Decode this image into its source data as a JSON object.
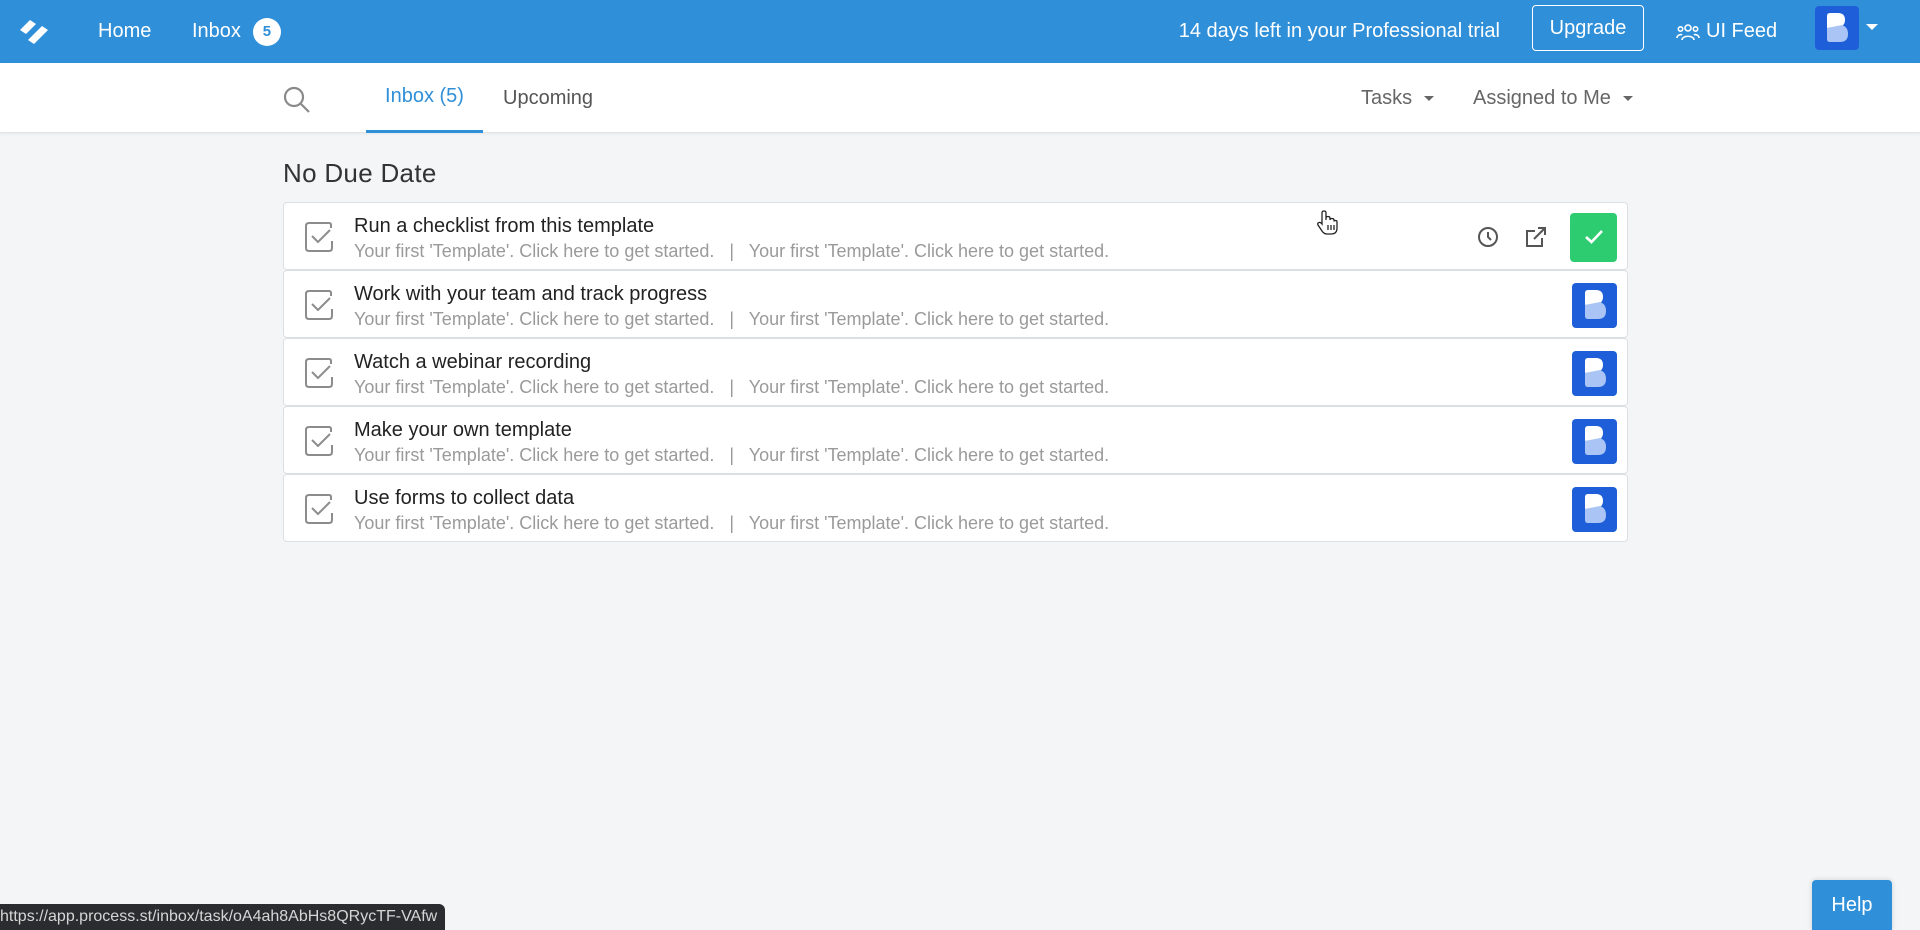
{
  "topnav": {
    "logo_icon": "process-street-logo",
    "home_label": "Home",
    "inbox_label": "Inbox",
    "inbox_count": "5",
    "trial_text": "14 days left in your Professional trial",
    "upgrade_label": "Upgrade",
    "uifeed_label": "UI Feed",
    "uifeed_icon": "users-icon",
    "avatar_icon": "user-avatar"
  },
  "subnav": {
    "search_icon": "search-icon",
    "tabs": [
      {
        "label": "Inbox (5)",
        "active": true
      },
      {
        "label": "Upcoming",
        "active": false
      }
    ],
    "filters": [
      {
        "label": "Tasks"
      },
      {
        "label": "Assigned to Me"
      }
    ]
  },
  "section": {
    "title": "No Due Date"
  },
  "tasks": [
    {
      "title": "Run a checklist from this template",
      "subtitle": "Your first 'Template'. Click here to get started.   |   Your first 'Template'. Click here to get started.",
      "hovered": true
    },
    {
      "title": "Work with your team and track progress",
      "subtitle": "Your first 'Template'. Click here to get started.   |   Your first 'Template'. Click here to get started.",
      "hovered": false
    },
    {
      "title": "Watch a webinar recording",
      "subtitle": "Your first 'Template'. Click here to get started.   |   Your first 'Template'. Click here to get started.",
      "hovered": false
    },
    {
      "title": "Make your own template",
      "subtitle": "Your first 'Template'. Click here to get started.   |   Your first 'Template'. Click here to get started.",
      "hovered": false
    },
    {
      "title": "Use forms to collect data",
      "subtitle": "Your first 'Template'. Click here to get started.   |   Your first 'Template'. Click here to get started.",
      "hovered": false
    }
  ],
  "colors": {
    "brand": "#2f8fd8",
    "complete": "#2ecc71",
    "avatar": "#1e5fd9"
  },
  "status_bar": {
    "url": "https://app.process.st/inbox/task/oA4ah8AbHs8QRycTF-VAfw"
  },
  "help_label": "Help"
}
